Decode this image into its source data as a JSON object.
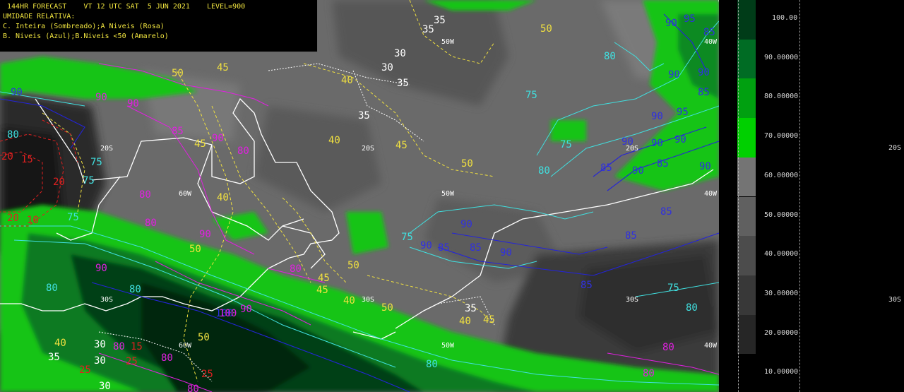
{
  "header": {
    "line1": " 144HR FORECAST    VT 12 UTC SAT  5 JUN 2021    LEVEL=900",
    "line2": "UMIDADE RELATIVA:",
    "line3": "C. Inteira (Sombreado);A Niveis (Rosa)",
    "line4": "B. Niveis (Azul);B.Niveis <50 (Amarelo)"
  },
  "colors": {
    "yellow": "#f0e040",
    "white": "#ffffff",
    "cyan": "#40e0e0",
    "blue": "#2020d0",
    "magenta": "#e020e0",
    "red": "#e02020",
    "green_light": "#10c010",
    "green_dark": "#003000"
  },
  "legend": {
    "scale": [
      "100.00",
      "90.00000",
      "80.00000",
      "70.00000",
      "60.00000",
      "50.00000",
      "40.00000",
      "30.00000",
      "20.00000",
      "10.00000"
    ],
    "swatches": [
      "#003c18",
      "#006c24",
      "#00a010",
      "#00d000",
      "#747474",
      "#606060",
      "#4c4c4c",
      "#383838",
      "#262626"
    ]
  },
  "map_labels": {
    "lat_20s": [
      "20S",
      "20S",
      "20S"
    ],
    "lat_30s": [
      "30S",
      "30S",
      "30S"
    ],
    "lon_50w": [
      "50W",
      "50W",
      "50W"
    ],
    "lon_40w": [
      "40W",
      "40W",
      "40W"
    ],
    "lon_60w": [
      "60W",
      "60W"
    ],
    "side_20s": "20S",
    "side_30s": "30S"
  },
  "contour_labels": {
    "yellow": [
      "50",
      "45",
      "40",
      "45",
      "40",
      "40",
      "50",
      "40",
      "50",
      "45",
      "45",
      "50",
      "40",
      "45",
      "50",
      "45",
      "40",
      "50",
      "50"
    ],
    "white": [
      "35",
      "30",
      "30",
      "35",
      "35",
      "35",
      "30",
      "35",
      "30",
      "30",
      "35"
    ],
    "cyan": [
      "80",
      "75",
      "75",
      "80",
      "75",
      "75",
      "80",
      "75",
      "80",
      "80",
      "75",
      "75",
      "80",
      "80"
    ],
    "blue": [
      "90",
      "95",
      "85",
      "90",
      "90",
      "85",
      "90",
      "95",
      "90",
      "90",
      "90",
      "85",
      "90",
      "85",
      "90",
      "85",
      "90",
      "85",
      "90",
      "85",
      "85",
      "90",
      "85",
      "90",
      "100"
    ],
    "magenta": [
      "90",
      "90",
      "85",
      "80",
      "80",
      "90",
      "80",
      "90",
      "80",
      "90",
      "90",
      "80",
      "100",
      "80",
      "80",
      "80",
      "80"
    ],
    "red": [
      "20",
      "15",
      "10",
      "20",
      "25",
      "25",
      "25",
      "15",
      "20"
    ]
  }
}
